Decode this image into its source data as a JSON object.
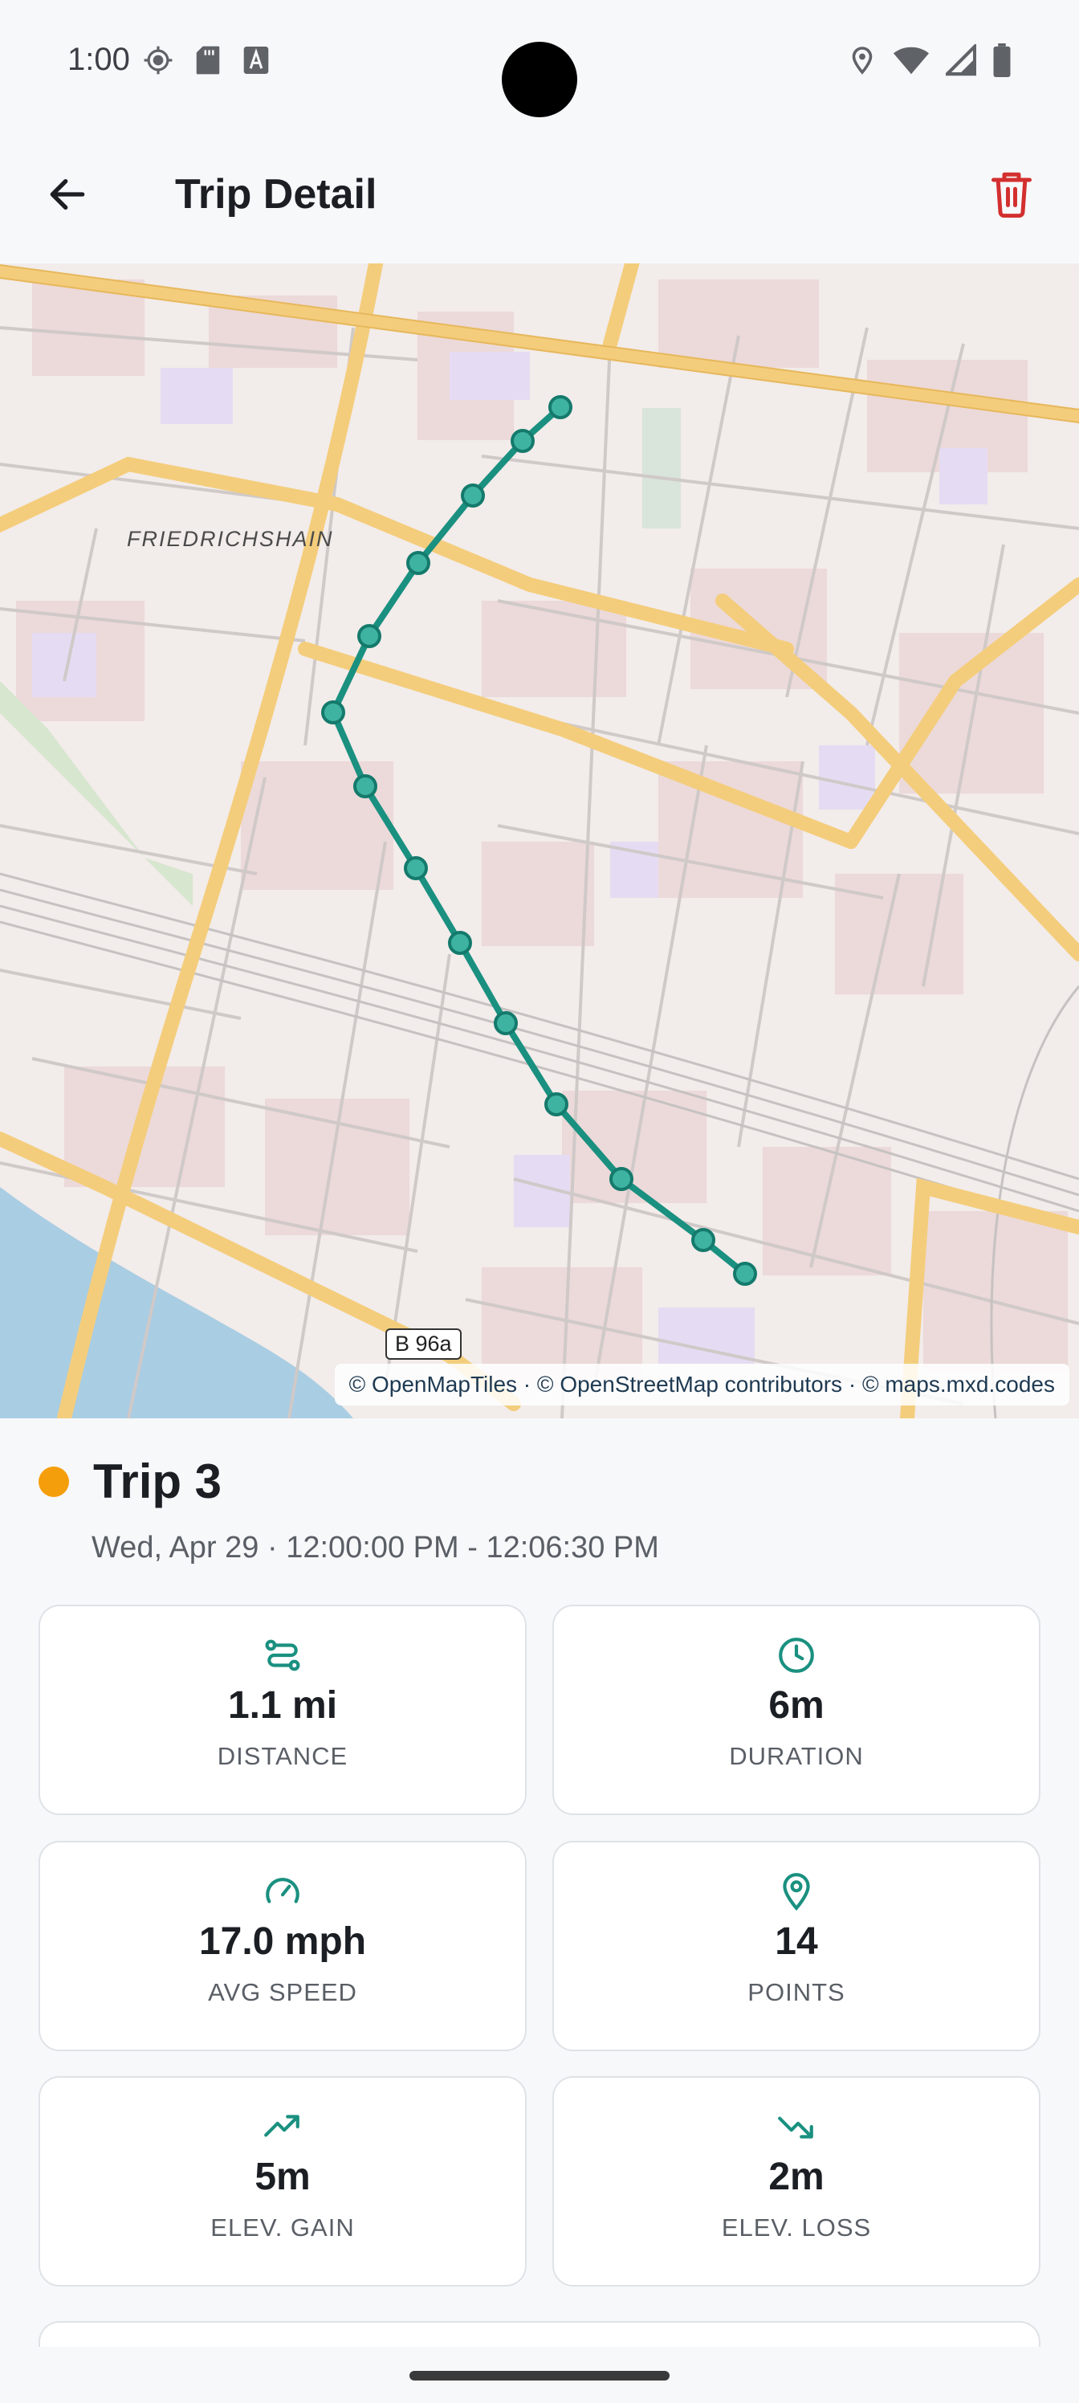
{
  "status_bar": {
    "time": "1:00",
    "icons_left": [
      "gps-icon",
      "sd-card-icon",
      "font-icon"
    ],
    "icons_right": [
      "location-icon",
      "wifi-icon",
      "signal-icon",
      "battery-icon"
    ]
  },
  "app_bar": {
    "title": "Trip Detail",
    "back_icon": "arrow-back-icon",
    "delete_icon": "trash-icon"
  },
  "map": {
    "area_label": "FRIEDRICHSHAIN",
    "road_shield": "B 96a",
    "attribution": "© OpenMapTiles · © OpenStreetMap contributors · © maps.mxd.codes",
    "route_color": "#1a9080"
  },
  "trip": {
    "dot_color": "#f59e0b",
    "title": "Trip 3",
    "time_range": "Wed, Apr 29 · 12:00:00 PM - 12:06:30 PM"
  },
  "stats": [
    {
      "icon": "route-icon",
      "value": "1.1 mi",
      "label": "DISTANCE"
    },
    {
      "icon": "clock-icon",
      "value": "6m",
      "label": "DURATION"
    },
    {
      "icon": "speedometer-icon",
      "value": "17.0 mph",
      "label": "AVG SPEED"
    },
    {
      "icon": "map-pin-icon",
      "value": "14",
      "label": "POINTS"
    },
    {
      "icon": "trending-up-icon",
      "value": "5m",
      "label": "ELEV. GAIN"
    },
    {
      "icon": "trending-down-icon",
      "value": "2m",
      "label": "ELEV. LOSS"
    }
  ],
  "colors": {
    "accent": "#1a9080",
    "delete": "#d32f2f"
  }
}
